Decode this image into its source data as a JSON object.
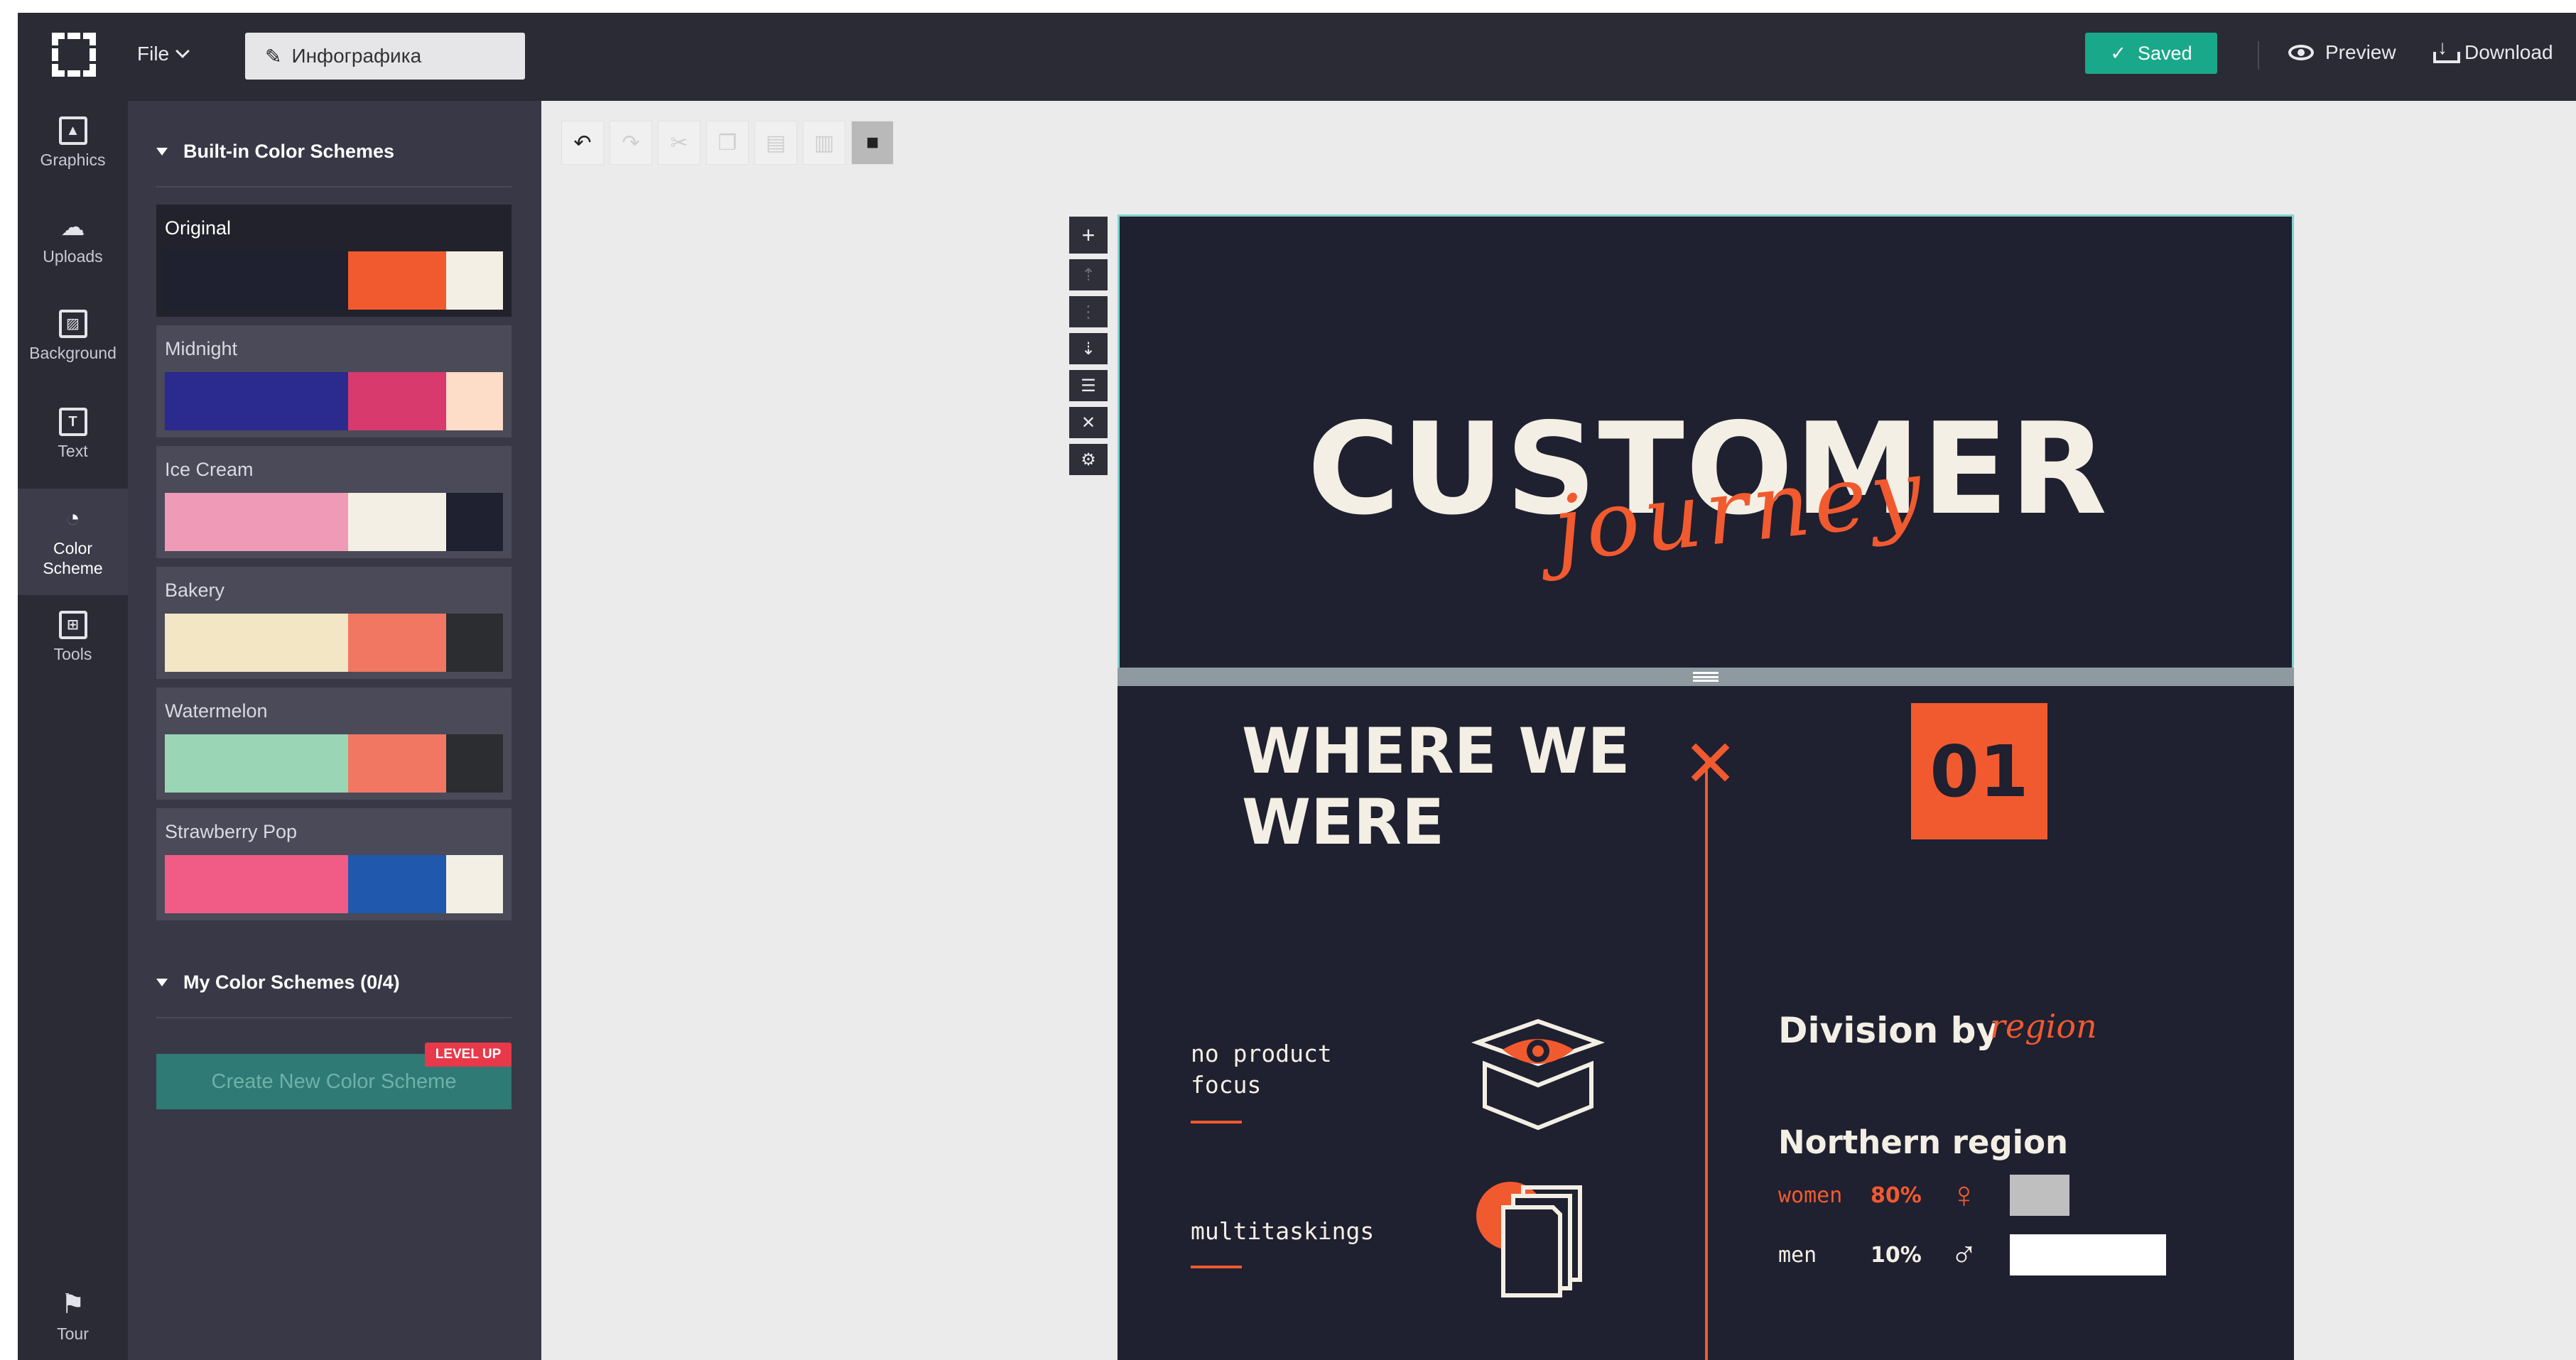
{
  "topbar": {
    "file_label": "File",
    "doc_title": "Инфографика",
    "saved_label": "Saved",
    "preview_label": "Preview",
    "download_label": "Download"
  },
  "rail": {
    "items": [
      {
        "label": "Graphics",
        "icon": "image-icon"
      },
      {
        "label": "Uploads",
        "icon": "cloud-upload-icon"
      },
      {
        "label": "Background",
        "icon": "hatch-icon"
      },
      {
        "label": "Text",
        "icon": "text-box-icon"
      },
      {
        "label": "Color Scheme",
        "icon": "palette-icon"
      },
      {
        "label": "Tools",
        "icon": "toolbox-icon"
      }
    ],
    "tour_label": "Tour"
  },
  "panel": {
    "builtin_heading": "Built-in Color Schemes",
    "schemes": [
      {
        "name": "Original",
        "colors": [
          "#1f2030",
          "#f15a2f",
          "#f4efe4"
        ]
      },
      {
        "name": "Midnight",
        "colors": [
          "#2b2a8f",
          "#d93a6d",
          "#fddcc8"
        ]
      },
      {
        "name": "Ice Cream",
        "colors": [
          "#ef9bb7",
          "#f4efe4",
          "#1f2030"
        ]
      },
      {
        "name": "Bakery",
        "colors": [
          "#f2e6c4",
          "#f17763",
          "#2b2d30"
        ]
      },
      {
        "name": "Watermelon",
        "colors": [
          "#9ad6b6",
          "#f17763",
          "#2b2d30"
        ]
      },
      {
        "name": "Strawberry Pop",
        "colors": [
          "#f05c86",
          "#2058ad",
          "#f4efe4"
        ]
      }
    ],
    "my_heading": "My Color Schemes (0/4)",
    "create_label": "Create New Color Scheme",
    "levelup_label": "LEVEL UP"
  },
  "canvas": {
    "title_main": "CUSTOMER",
    "title_script": "journey",
    "section_title_line1": "WHERE WE",
    "section_title_line2": "WERE",
    "step_number": "01",
    "item1": "no product focus",
    "item2": "multitaskings",
    "division_title": "Division by",
    "division_script": "region",
    "region_name": "Northern region",
    "stats": [
      {
        "label": "women",
        "pct": "80%",
        "fraction": 0.8
      },
      {
        "label": "men",
        "pct": "10%",
        "fraction": 0.1
      }
    ]
  },
  "colors": {
    "accent": "#f15a2f",
    "canvas_bg": "#1f2030",
    "cream": "#f4efe4",
    "saved_green": "#1aa88a"
  }
}
